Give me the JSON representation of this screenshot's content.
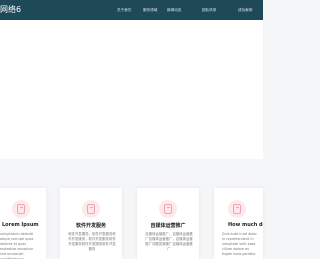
{
  "header": {
    "brand": "网络6",
    "nav": [
      "关于我们",
      "服务领域",
      "新闻动态",
      "团队风采",
      "成功案例"
    ],
    "background": "#1e4a57"
  },
  "cards": [
    {
      "icon": "document-icon",
      "title": "Lorem Ipsum",
      "text": "voluptatum deleniti atque corrupti quos dolores et quas molestias excepturi sint occaecati cupiditate non"
    },
    {
      "icon": "document-icon",
      "title": "软件开发服务",
      "text": "软件开发服务，软件开发服务软件开发服务，软件开发服务软件开发服务软件开发服务软件开发服务"
    },
    {
      "icon": "document-icon",
      "title": "自媒体运营推广",
      "text": "自媒体运营推广，百媒体运营推广自媒体运营推广，自媒体运营推广问题答案推广自媒体运营推广"
    },
    {
      "icon": "document-icon",
      "title": "How much doubt",
      "text": "Duis aute irure dolor in reprehenderit in voluptate velit esse cillum dolore eu fugiat nulla pariatur"
    }
  ],
  "colors": {
    "icon_bg": "#fde9ec",
    "icon_fg": "#f2a3b0",
    "page_bg": "#f5f6f8"
  }
}
